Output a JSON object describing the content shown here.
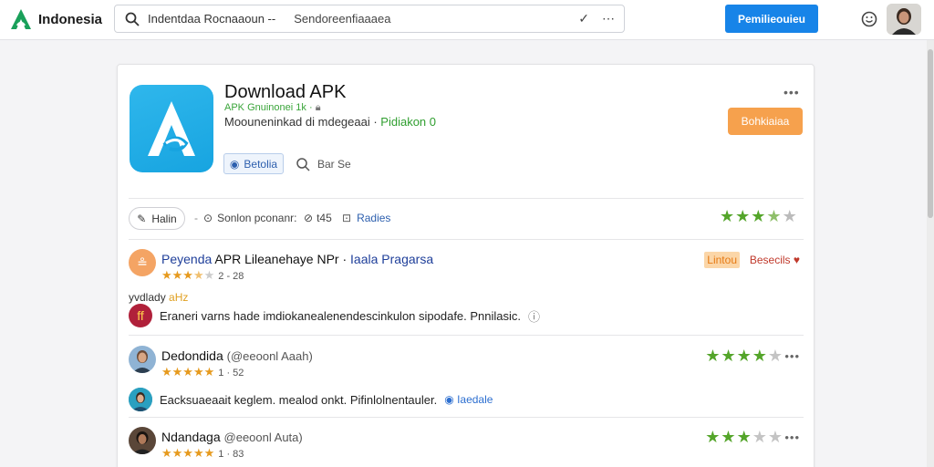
{
  "topbar": {
    "brand": "Indonesia",
    "search_query": "Indentdaa Rocnaaoun --",
    "search_suffix": "Sendoreenfiaaaea",
    "primary_button": "Pemilieouieu"
  },
  "app": {
    "title": "Download APK",
    "subtitle": "APK Gnuinonei 1k ·",
    "description": "Moouneninkad di mdegeaai ·",
    "description_green": "Pidiakon 0",
    "beta_label": "Betolia",
    "share_label": "Bar Se",
    "action_button": "Bohkiaiaa"
  },
  "toolbar": {
    "write_label": "Halin",
    "dash": "-",
    "sort_label": "Sonlon pconanr:",
    "count_label": "t45",
    "filter_label": "Radies",
    "rating": 3.5
  },
  "reviews": [
    {
      "name": "Peyenda",
      "name_rest": "APR Lileanehaye NPr · ",
      "name_link": "Iaala Pragarsa",
      "rating": 3.5,
      "rating_text": "2 - 28",
      "tag": "Lintou",
      "badge": "Besecils",
      "label_text": "yvdlady",
      "label_highlight": "aHz",
      "comment": "Eraneri varns hade imdiokanealenendescinkulon sipodafe. Pnnilasic."
    },
    {
      "name": "Dedondida",
      "handle": "(@eeoonl Aaah)",
      "rating": 5,
      "rating_text": "1 · 52",
      "right_rating": 4,
      "comment": "Eacksuaeaait keglem. mealod onkt. Pifinlolnentauler.",
      "comment_link": "Iaedale"
    },
    {
      "name": "Ndandaga",
      "handle": "@eeoonl Auta)",
      "rating": 5,
      "rating_text": "1 · 83",
      "right_rating": 3
    }
  ],
  "colors": {
    "accent": "#1784e8",
    "app_icon": "#17a4e0",
    "orange": "#f6a14d",
    "star_green": "#54a52a",
    "star_gold": "#e69a1e"
  }
}
